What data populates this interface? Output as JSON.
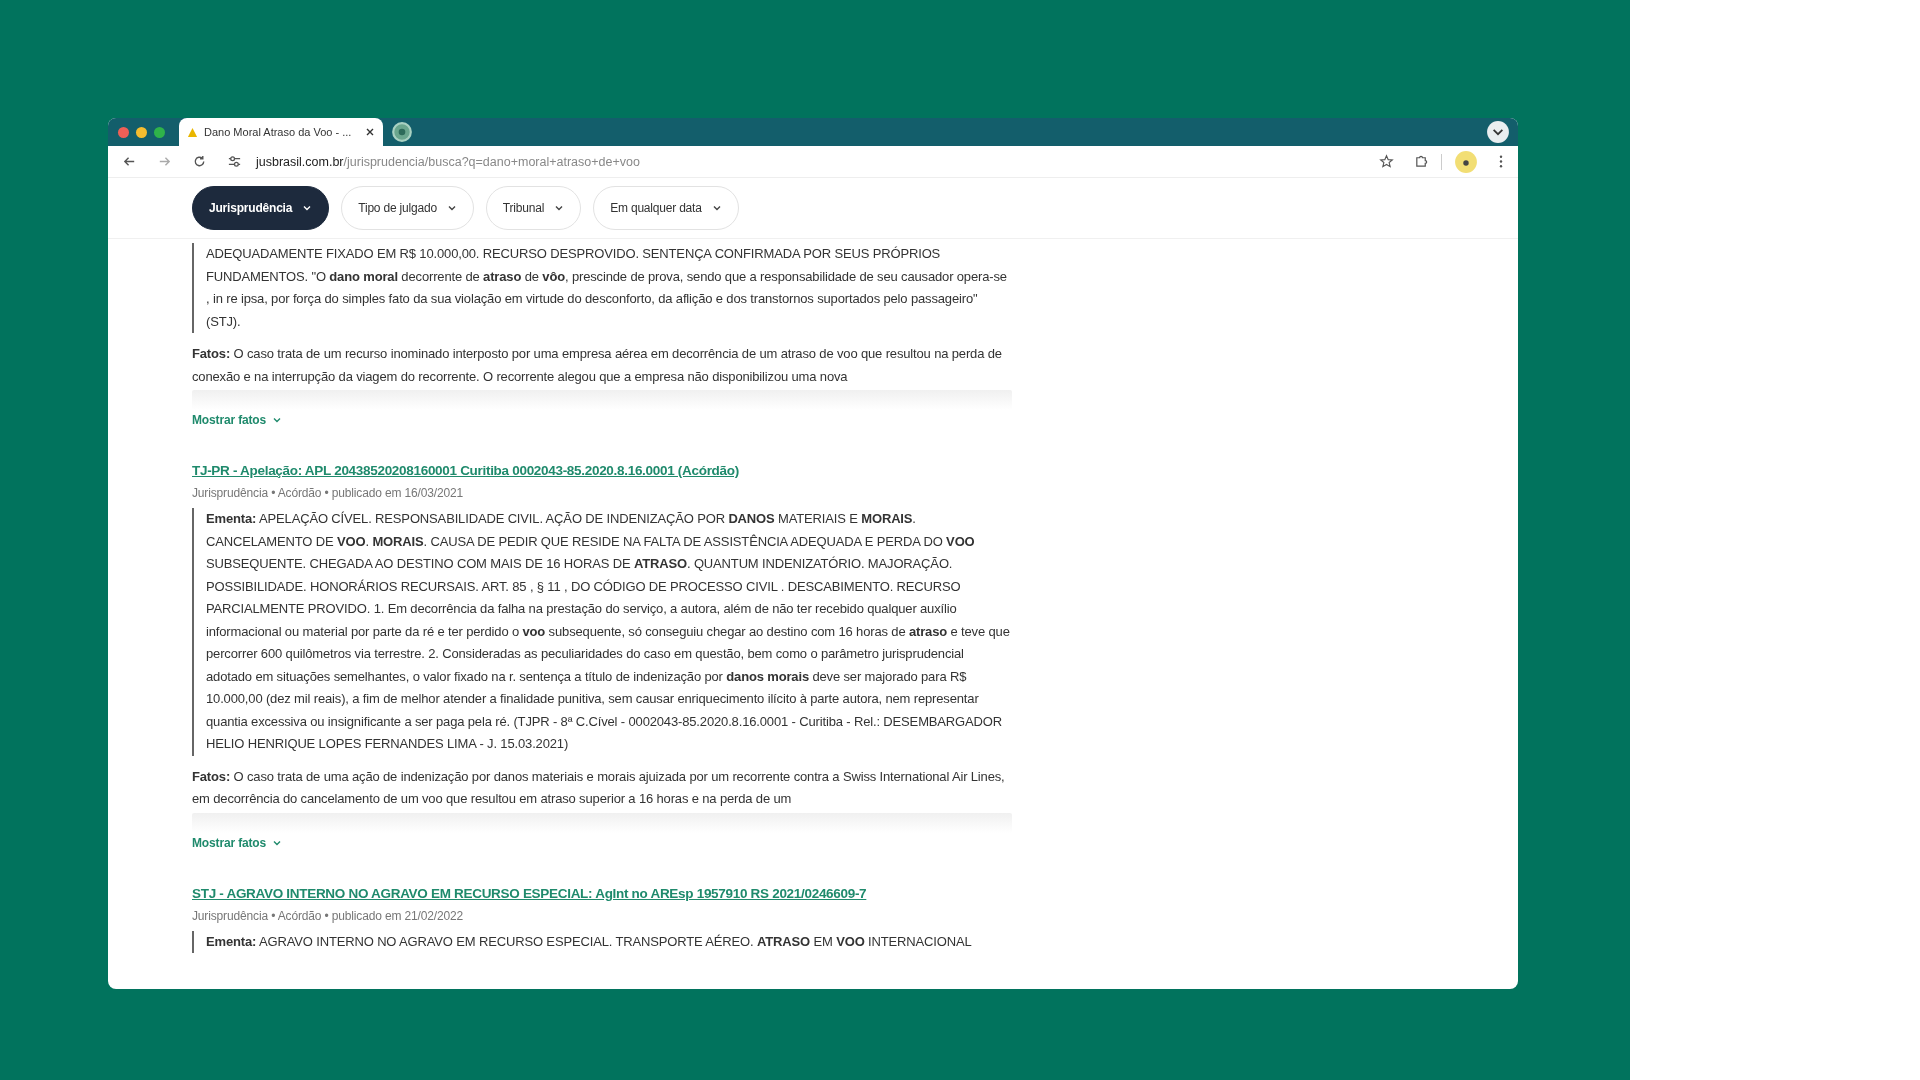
{
  "browser": {
    "tab": {
      "title": "Dano Moral Atraso da Voo - ..."
    },
    "url": {
      "domain": "jusbrasil.com.br",
      "path": "/jurisprudencia/busca?q=dano+moral+atraso+de+voo"
    }
  },
  "filters": [
    {
      "label": "Jurisprudência",
      "selected": true
    },
    {
      "label": "Tipo de julgado",
      "selected": false
    },
    {
      "label": "Tribunal",
      "selected": false
    },
    {
      "label": "Em qualquer data",
      "selected": false
    }
  ],
  "results": [
    {
      "ementa": "ADEQUADAMENTE FIXADO EM R$ 10.000,00. RECURSO DESPROVIDO. SENTENÇA CONFIRMADA POR SEUS PRÓPRIOS FUNDAMENTOS. \"O **dano moral** decorrente de **atraso** de **vôo**, prescinde de prova, sendo que a responsabilidade de seu causador opera-se , in re ipsa, por força do simples fato da sua violação em virtude do desconforto, da aflição e dos transtornos suportados pelo passageiro\" (STJ).",
      "fatos": "**Fatos:** O caso trata de um recurso inominado interposto por uma empresa aérea em decorrência de um atraso de voo que resultou na perda de conexão e na interrupção da viagem do recorrente. O recorrente alegou que a empresa não disponibilizou uma nova",
      "toggle": "Mostrar fatos"
    },
    {
      "title": "TJ-PR - Apelação: APL 20438520208160001 Curitiba 0002043-85.2020.8.16.0001 (Acórdão)",
      "meta": "Jurisprudência • Acórdão • publicado em 16/03/2021",
      "ementa": "**Ementa:** APELAÇÃO CÍVEL. RESPONSABILIDADE CIVIL. AÇÃO DE INDENIZAÇÃO POR **DANOS** MATERIAIS E **MORAIS**. CANCELAMENTO DE **VOO**. **MORAIS**. CAUSA DE PEDIR QUE RESIDE NA FALTA DE ASSISTÊNCIA ADEQUADA E PERDA DO **VOO** SUBSEQUENTE. CHEGADA AO DESTINO COM MAIS DE 16 HORAS DE **ATRASO**. QUANTUM INDENIZATÓRIO. MAJORAÇÃO. POSSIBILIDADE. HONORÁRIOS RECURSAIS. ART. 85 , § 11 , DO CÓDIGO DE PROCESSO CIVIL . DESCABIMENTO. RECURSO PARCIALMENTE PROVIDO. 1. Em decorrência da falha na prestação do serviço, a autora, além de não ter recebido qualquer auxílio informacional ou material por parte da ré e ter perdido o **voo** subsequente, só conseguiu chegar ao destino com 16 horas de **atraso** e teve que percorrer 600 quilômetros via terrestre. 2. Consideradas as peculiaridades do caso em questão, bem como o parâmetro jurisprudencial adotado em situações semelhantes, o valor fixado na r. sentença a título de indenização por **danos morais** deve ser majorado para R$ 10.000,00 (dez mil reais), a fim de melhor atender a finalidade punitiva, sem causar enriquecimento ilícito à parte autora, nem representar quantia excessiva ou insignificante a ser paga pela ré. (TJPR - 8ª C.Cível - 0002043-85.2020.8.16.0001 - Curitiba - Rel.: DESEMBARGADOR HELIO HENRIQUE LOPES FERNANDES LIMA - J. 15.03.2021)",
      "fatos": "**Fatos:** O caso trata de uma ação de indenização por danos materiais e morais ajuizada por um recorrente contra a Swiss International Air Lines, em decorrência do cancelamento de um voo que resultou em atraso superior a 16 horas e na perda de um",
      "toggle": "Mostrar fatos"
    },
    {
      "title": "STJ - AGRAVO INTERNO NO AGRAVO EM RECURSO ESPECIAL: AgInt no AREsp 1957910 RS 2021/0246609-7",
      "meta": "Jurisprudência • Acórdão • publicado em 21/02/2022",
      "ementa": "**Ementa:** AGRAVO INTERNO NO AGRAVO EM RECURSO ESPECIAL. TRANSPORTE AÉREO. **ATRASO** EM **VOO** INTERNACIONAL"
    }
  ]
}
